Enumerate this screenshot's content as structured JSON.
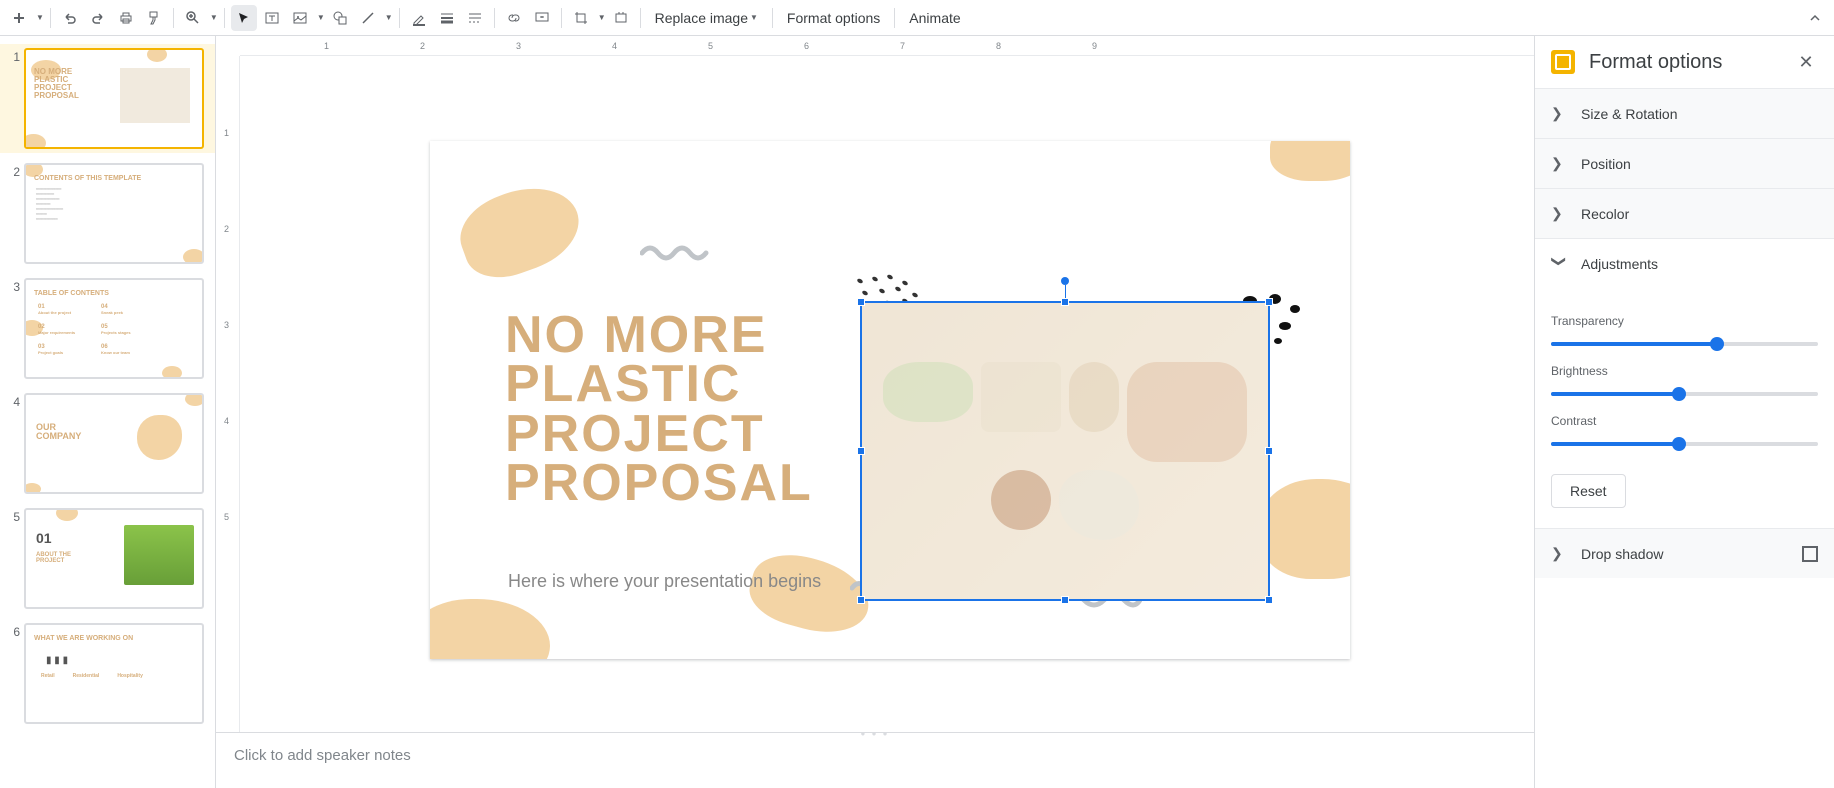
{
  "toolbar": {
    "replace_image": "Replace image",
    "format_options": "Format options",
    "animate": "Animate"
  },
  "thumbs": [
    {
      "num": "1",
      "title": "NO MORE\nPLASTIC\nPROJECT\nPROPOSAL"
    },
    {
      "num": "2",
      "title": "CONTENTS OF THIS TEMPLATE"
    },
    {
      "num": "3",
      "title": "TABLE OF CONTENTS"
    },
    {
      "num": "4",
      "title": "OUR\nCOMPANY"
    },
    {
      "num": "5",
      "title": "01\nABOUT THE\nPROJECT"
    },
    {
      "num": "6",
      "title": "WHAT WE ARE WORKING ON"
    }
  ],
  "slide": {
    "title": "NO MORE\nPLASTIC\nPROJECT\nPROPOSAL",
    "subtitle": "Here is where your presentation begins"
  },
  "ruler_h": [
    "1",
    "2",
    "3",
    "4",
    "5",
    "6",
    "7",
    "8",
    "9"
  ],
  "ruler_v": [
    "1",
    "2",
    "3",
    "4",
    "5"
  ],
  "notes_placeholder": "Click to add speaker notes",
  "format_panel": {
    "title": "Format options",
    "sections": {
      "size_rotation": "Size & Rotation",
      "position": "Position",
      "recolor": "Recolor",
      "adjustments": "Adjustments",
      "drop_shadow": "Drop shadow"
    },
    "sliders": {
      "transparency": {
        "label": "Transparency",
        "value": 62
      },
      "brightness": {
        "label": "Brightness",
        "value": 48
      },
      "contrast": {
        "label": "Contrast",
        "value": 48
      }
    },
    "reset": "Reset"
  }
}
